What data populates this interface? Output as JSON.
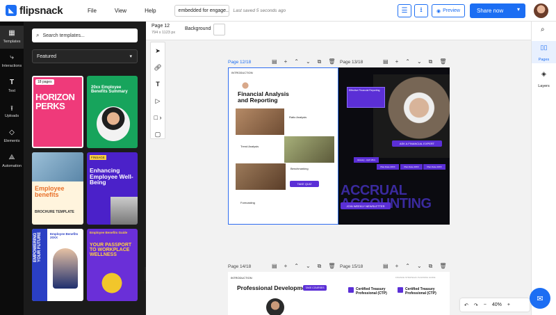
{
  "app": {
    "brand": "flipsnack"
  },
  "menu": {
    "file": "File",
    "view": "View",
    "help": "Help"
  },
  "document": {
    "name": "embedded for engage...",
    "saved_status": "Last saved 5 seconds ago"
  },
  "toolbar": {
    "preview_label": "Preview",
    "share_label": "Share now"
  },
  "left_rail": [
    {
      "label": "Templates",
      "icon": "templates-icon"
    },
    {
      "label": "Interactions",
      "icon": "interactions-icon"
    },
    {
      "label": "Text",
      "icon": "text-icon"
    },
    {
      "label": "Uploads",
      "icon": "uploads-icon"
    },
    {
      "label": "Elements",
      "icon": "elements-icon"
    },
    {
      "label": "Automation",
      "icon": "automation-icon"
    }
  ],
  "templates_panel": {
    "search_placeholder": "Search templates...",
    "filter_selected": "Featured",
    "templates": [
      {
        "badge": "18 pages",
        "title": "HORIZON PERKS"
      },
      {
        "title": "20xx Employee Benefits Summary"
      },
      {
        "title": "Employee benefits",
        "subtitle": "BROCHURE TEMPLATE"
      },
      {
        "title": "Enhancing Employee Well-Being",
        "badge": "FINSAGE"
      },
      {
        "title": "EMPOWERING YOUR FUTURE",
        "subtitle": "Employee Benefits 20XX"
      },
      {
        "title": "YOUR PASSPORT TO WORKPLACE WELLNESS",
        "subtitle": "Employee Benefits Guide"
      }
    ]
  },
  "canvas_toolbar": {
    "page_label": "Page 12",
    "page_size": "794 x 1123 px",
    "background_label": "Background",
    "background_color": "#ffffff"
  },
  "spread_1": {
    "left_label": "Page 12/18",
    "right_label": "Page 13/18",
    "left_page": {
      "section": "INTRODUCTION",
      "heading": "Financial Analysis and Reporting",
      "labels": [
        "Ratio Analysis",
        "Trend Analysis",
        "Benchmarking",
        "Forecasting"
      ],
      "cta": "TAKE QUIZ"
    },
    "right_page": {
      "card_title": "Effective Financial Reporting",
      "cta_expert": "ASK A FINANCIAL EXPERT",
      "big_text": "ACCRUAL ACCOUNTING",
      "cta_newsletter": "JOIN WEEKLY NEWSLETTER",
      "tags": [
        "January - April 20xx",
        "Plan Date 20XX",
        "Plan Date 20XX",
        "Plan Date 20XX"
      ]
    }
  },
  "spread_2": {
    "left_label": "Page 14/18",
    "right_label": "Page 15/18",
    "left_page": {
      "section": "INTRODUCTION",
      "heading": "Professional Development",
      "tag": "TAKE COURSES"
    },
    "right_page": {
      "header": "FINANCE STRATEGIC PLANNING GUIDE",
      "cert1": "Certified Treasury Professional (CTP)",
      "cert2": "Certified Treasury Professional (CTP)"
    }
  },
  "right_rail": [
    {
      "label": "Pages",
      "icon": "pages-icon"
    },
    {
      "label": "Layers",
      "icon": "layers-icon"
    }
  ],
  "zoom": {
    "level": "40%"
  },
  "colors": {
    "accent": "#1c6ef3",
    "purple": "#5b2fd6",
    "dark_page": "#0b0b10"
  }
}
